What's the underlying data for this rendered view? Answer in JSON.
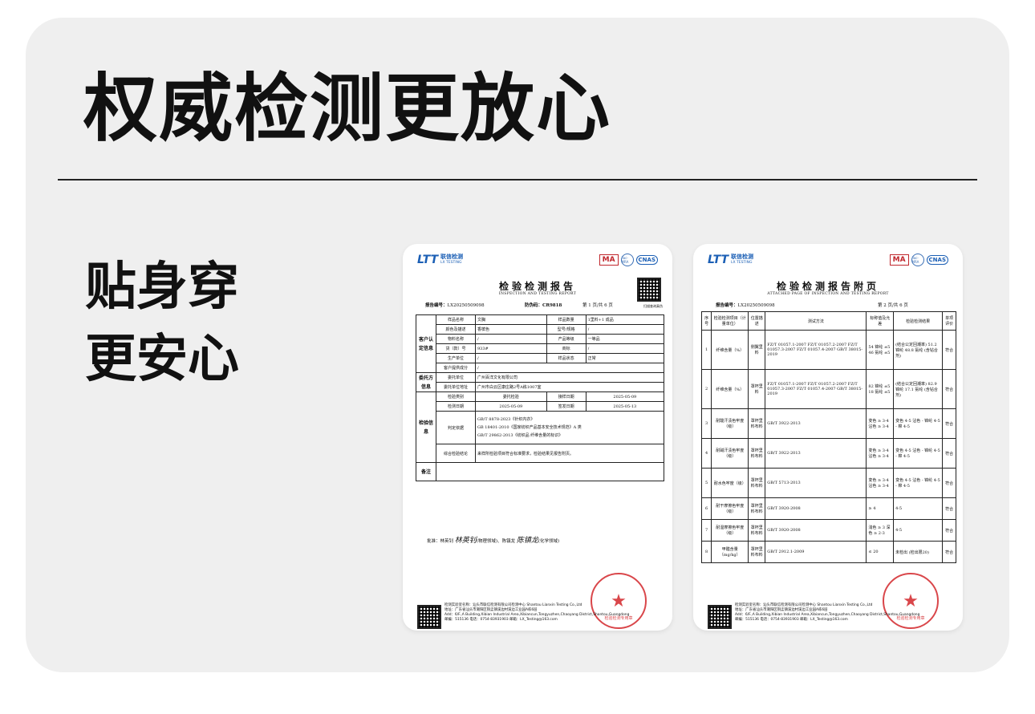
{
  "headline": "权威检测更放心",
  "subheadline": [
    "贴身穿",
    "更安心"
  ],
  "colors": {
    "panel": "#efefef",
    "text": "#111111",
    "logo_blue": "#1b5fb5",
    "stamp_red": "#d3262b"
  },
  "logo": {
    "mark": "LTT",
    "name_cn": "联信检测",
    "name_en": "LX TESTING"
  },
  "certs": {
    "ma": "MA",
    "ilac": "ilac-MRA",
    "cnas": "CNAS"
  },
  "report": {
    "title": "检验检测报告",
    "subtitle": "INSPECTION AND TESTING REPORT",
    "qr_caption": "扫描查询真伪",
    "report_no_label": "报告编号：",
    "report_no": "LX20250509098",
    "anti_fake_label": "防伪码：",
    "anti_fake": "CR9818",
    "page": "第 1 页/共 6 页",
    "groups": {
      "customer": "客户认定信息",
      "entrust": "委托方信息",
      "inspect": "检验信息",
      "remark": "备注"
    },
    "rows": [
      {
        "l1": "样品名称",
        "v1": "文胸",
        "l2": "样品数量",
        "v2": "1里料+1 成品"
      },
      {
        "l1": "颜色及描述",
        "v1": "香槟色",
        "l2": "型号/规格",
        "v2": "/"
      },
      {
        "l1": "物料名称",
        "v1": "/",
        "l2": "产品等级",
        "v2": "一等品"
      },
      {
        "l1": "货（款）号",
        "v1": "933#",
        "l2": "商标",
        "v2": "/"
      },
      {
        "l1": "生产单位",
        "v1": "/",
        "l2": "样品状态",
        "v2": "正常"
      },
      {
        "l1": "客户提供成分",
        "v1": "/"
      }
    ],
    "entrust_rows": [
      {
        "l": "委托单位",
        "v": "广州百洋文化有限公司"
      },
      {
        "l": "委托单位地址",
        "v": "广州市白云区康庄路2号A栋1007室"
      }
    ],
    "inspect_rows": {
      "type_label": "检验类别",
      "type": "委托检验",
      "recv_label": "接样日期",
      "recv": "2025-05-09",
      "date_label": "检测日期",
      "date": "2025-05-09",
      "sign_label": "签发日期",
      "sign": "2025-05-13",
      "basis_label": "判定依据",
      "basis": [
        "GB/T 8878-2023《针织内衣》",
        "GB 18401-2010《国家纺织产品基本安全技术规范》A 类",
        "GB/T 29862-2013《纺织品 纤维含量的标识》"
      ],
      "conclusion_label": "综合检验结论",
      "conclusion": "来样所检验项目符合标准要求，检验结果见报告附页。"
    },
    "signers": "批准：林英钊",
    "signer_hand": "林英钊",
    "signers_rest": "(物理领域)、陈镇龙",
    "signer_hand2": "陈镇龙",
    "signers_rest2": "(化学领域)"
  },
  "attached": {
    "title": "检验检测报告附页",
    "subtitle": "ATTACHED PAGE OF INSPECTION AND TESTING REPORT",
    "report_no_label": "报告编号：",
    "report_no": "LX20250509098",
    "page": "第 2 页/共 6 页",
    "headers": [
      "序号",
      "检验检测项目（计量单位）",
      "位置描述",
      "测试方法",
      "标称值及允差",
      "检验检测结果",
      "单项评价"
    ],
    "rows": [
      {
        "no": "1",
        "item": "纤维含量（%）",
        "pos": "侧翼里料",
        "method": "FZ/T 01057.1-2007 FZ/T 01057.2-2007 FZ/T 01057.3-2007 FZ/T 01057.4-2007 GB/T 38015-2019",
        "nominal": "54 锦纶 ±5 46 氨纶 ±5",
        "result": "(结合公定回潮率) 51.2 锦纶 48.8 氨纶 (含钻合剂)",
        "eval": "符合"
      },
      {
        "no": "2",
        "item": "纤维含量（%）",
        "pos": "罩杯里料",
        "method": "FZ/T 01057.1-2007 FZ/T 01057.2-2007 FZ/T 01057.3-2007 FZ/T 01057.4-2007 GB/T 38015-2019",
        "nominal": "82 锦纶 ±5 18 氨纶 ±5",
        "result": "(结合公定回潮率) 82.9 锦纶 17.1 氨纶 (含钻合剂)",
        "eval": "符合"
      },
      {
        "no": "3",
        "item": "耐酸汗渍色牢度（级）",
        "pos": "罩杯里料布料",
        "method": "GB/T 3922-2013",
        "nominal": "变色 ≥ 3-4 沾色 ≥ 3-4",
        "result": "变色 4-5 沾色 - 锦纶 4-5 - 棉 4-5",
        "eval": "符合"
      },
      {
        "no": "4",
        "item": "耐碱汗渍色牢度（级）",
        "pos": "罩杯里料布料",
        "method": "GB/T 3922-2013",
        "nominal": "变色 ≥ 3-4 沾色 ≥ 3-4",
        "result": "变色 4-5 沾色 - 锦纶 4-5 - 棉 4-5",
        "eval": "符合"
      },
      {
        "no": "5",
        "item": "耐水色牢度（级）",
        "pos": "罩杯里料布料",
        "method": "GB/T 5713-2013",
        "nominal": "变色 ≥ 3-4 沾色 ≥ 3-4",
        "result": "变色 4-5 沾色 - 锦纶 4-5 - 棉 4-5",
        "eval": "符合"
      },
      {
        "no": "6",
        "item": "耐干摩擦色牢度（级）",
        "pos": "罩杯里料布料",
        "method": "GB/T 3920-2008",
        "nominal": "≥ 4",
        "result": "4-5",
        "eval": "符合"
      },
      {
        "no": "7",
        "item": "耐湿摩擦色牢度（级）",
        "pos": "罩杯里料布料",
        "method": "GB/T 3920-2008",
        "nominal": "浅色 ≥ 3 深色 ≥ 2-3",
        "result": "4-5",
        "eval": "符合"
      },
      {
        "no": "8",
        "item": "甲醛含量（mg/kg）",
        "pos": "罩杯里料布料",
        "method": "GB/T 2912.1-2009",
        "nominal": "≤ 20",
        "result": "未检出 (检出限20)",
        "eval": "符合"
      }
    ]
  },
  "stamp_text": "检验检测专用章",
  "footer": {
    "line1": "检测实验室名称：汕头市联信检测有限公司检测中心  Shantou Lianxin Testing Co.,Ltd",
    "line2": "地址：广东省汕头市潮阳区铜盂镇溪边村溪边工业园A栋6层",
    "line3": "Add：6/F.,A Building,Xibian Industrial Area,Xibiancun,Tongyuzhen,Chaoyang District,Shantou,Guangdong",
    "line4": "邮编：515136  电话：0754-83931903  邮箱：LX_Testing@163.com"
  }
}
